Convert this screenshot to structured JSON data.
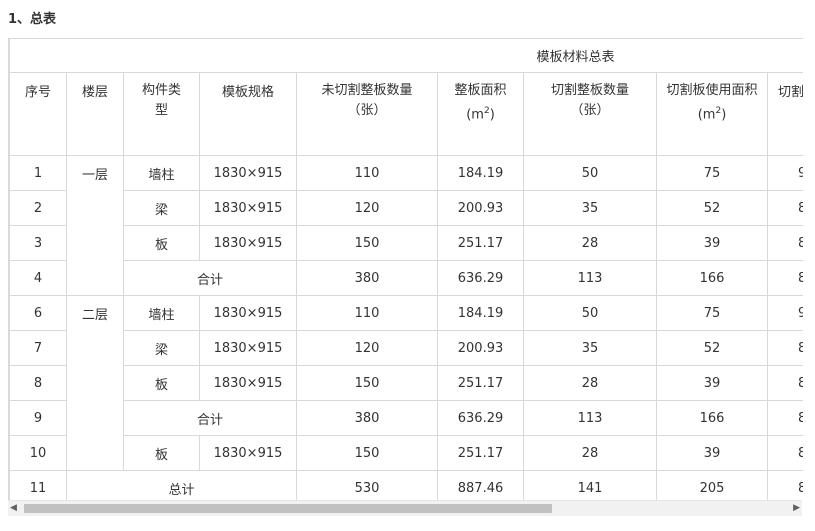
{
  "heading": "1、总表",
  "table_title": "模板材料总表",
  "header": {
    "col1": "序号",
    "col2": "楼层",
    "col3": "构件类型",
    "col4": "模板规格",
    "col5_l1": "未切割整板数量",
    "col5_l2": "（张）",
    "col6_l1": "整板面积",
    "col6_unit_base": "(m",
    "col6_unit_sup": "2",
    "col6_unit_close": ")",
    "col7_l1": "切割整板数量",
    "col7_l2": "（张）",
    "col8_l1": "切割板使用面积",
    "col8_unit_base": "(m",
    "col8_unit_sup": "2",
    "col8_unit_close": ")",
    "col9_partial": "切割"
  },
  "rows": [
    {
      "no": "1",
      "floor": "一层",
      "type": "墙柱",
      "spec": "1830×915",
      "uncut": "110",
      "area": "184.19",
      "cut": "50",
      "cut_area": "75",
      "extra": "9"
    },
    {
      "no": "2",
      "type": "梁",
      "spec": "1830×915",
      "uncut": "120",
      "area": "200.93",
      "cut": "35",
      "cut_area": "52",
      "extra": "8"
    },
    {
      "no": "3",
      "type": "板",
      "spec": "1830×915",
      "uncut": "150",
      "area": "251.17",
      "cut": "28",
      "cut_area": "39",
      "extra": "8"
    },
    {
      "no": "4",
      "subtotal": "合计",
      "uncut": "380",
      "area": "636.29",
      "cut": "113",
      "cut_area": "166",
      "extra": "8"
    },
    {
      "no": "6",
      "floor": "二层",
      "type": "墙柱",
      "spec": "1830×915",
      "uncut": "110",
      "area": "184.19",
      "cut": "50",
      "cut_area": "75",
      "extra": "9"
    },
    {
      "no": "7",
      "type": "梁",
      "spec": "1830×915",
      "uncut": "120",
      "area": "200.93",
      "cut": "35",
      "cut_area": "52",
      "extra": "8"
    },
    {
      "no": "8",
      "type": "板",
      "spec": "1830×915",
      "uncut": "150",
      "area": "251.17",
      "cut": "28",
      "cut_area": "39",
      "extra": "8"
    },
    {
      "no": "9",
      "subtotal": "合计",
      "uncut": "380",
      "area": "636.29",
      "cut": "113",
      "cut_area": "166",
      "extra": "8"
    },
    {
      "no": "10",
      "type": "板",
      "spec": "1830×915",
      "uncut": "150",
      "area": "251.17",
      "cut": "28",
      "cut_area": "39",
      "extra": "8"
    },
    {
      "no": "11",
      "total": "总计",
      "uncut": "530",
      "area": "887.46",
      "cut": "141",
      "cut_area": "205",
      "extra": "8"
    }
  ],
  "icons": {
    "scroll_left": "triangle-left",
    "scroll_right": "triangle-right"
  },
  "colors": {
    "border": "#d9d9d9",
    "text": "#333333",
    "scroll_thumb": "#c1c1c1",
    "scroll_track": "#f1f1f1"
  }
}
